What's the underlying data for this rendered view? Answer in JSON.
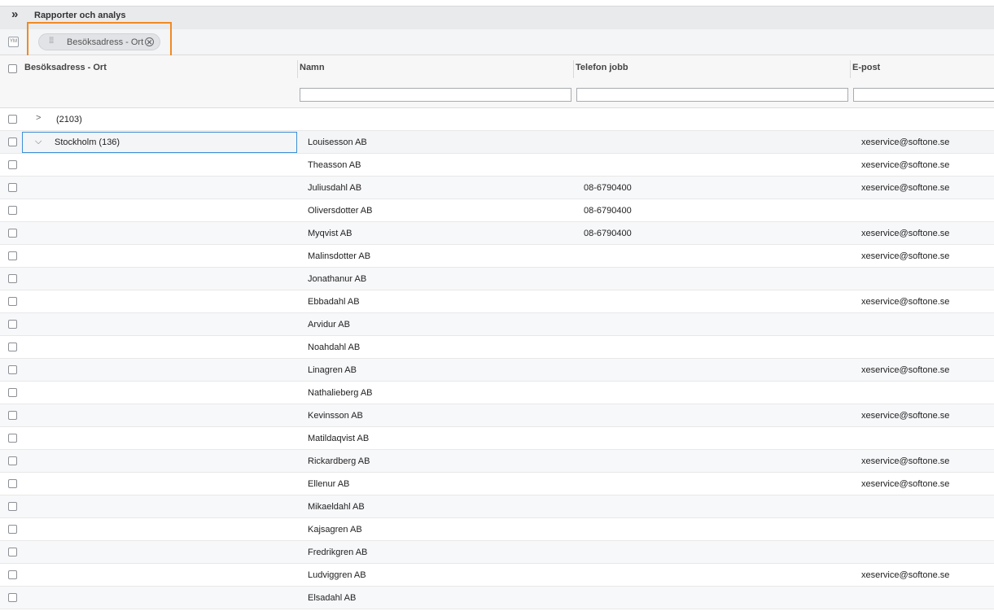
{
  "app": {
    "expand_glyph": "»",
    "title": "Rapporter och analys"
  },
  "groupbar": {
    "group_icon_text": "YM",
    "chip": {
      "label": "Besöksadress - Ort",
      "remove_glyph": "⊗"
    }
  },
  "columns": [
    {
      "label": "Besöksadress - Ort"
    },
    {
      "label": "Namn"
    },
    {
      "label": "Telefon jobb"
    },
    {
      "label": "E-post"
    }
  ],
  "groups": [
    {
      "label": "(2103)",
      "expanded": false
    },
    {
      "label": "Stockholm (136)",
      "expanded": true
    }
  ],
  "rows": [
    {
      "name": "Louisesson AB",
      "phone": "",
      "email": "xeservice@softone.se"
    },
    {
      "name": "Theasson AB",
      "phone": "",
      "email": "xeservice@softone.se"
    },
    {
      "name": "Juliusdahl AB",
      "phone": "08-6790400",
      "email": "xeservice@softone.se"
    },
    {
      "name": "Oliversdotter AB",
      "phone": "08-6790400",
      "email": ""
    },
    {
      "name": "Myqvist AB",
      "phone": "08-6790400",
      "email": "xeservice@softone.se"
    },
    {
      "name": "Malinsdotter AB",
      "phone": "",
      "email": "xeservice@softone.se"
    },
    {
      "name": "Jonathanur AB",
      "phone": "",
      "email": ""
    },
    {
      "name": "Ebbadahl AB",
      "phone": "",
      "email": "xeservice@softone.se"
    },
    {
      "name": "Arvidur AB",
      "phone": "",
      "email": ""
    },
    {
      "name": "Noahdahl AB",
      "phone": "",
      "email": ""
    },
    {
      "name": "Linagren AB",
      "phone": "",
      "email": "xeservice@softone.se"
    },
    {
      "name": "Nathalieberg AB",
      "phone": "",
      "email": ""
    },
    {
      "name": "Kevinsson AB",
      "phone": "",
      "email": "xeservice@softone.se"
    },
    {
      "name": "Matildaqvist AB",
      "phone": "",
      "email": ""
    },
    {
      "name": "Rickardberg AB",
      "phone": "",
      "email": "xeservice@softone.se"
    },
    {
      "name": "Ellenur AB",
      "phone": "",
      "email": "xeservice@softone.se"
    },
    {
      "name": "Mikaeldahl AB",
      "phone": "",
      "email": ""
    },
    {
      "name": "Kajsagren AB",
      "phone": "",
      "email": ""
    },
    {
      "name": "Fredrikgren AB",
      "phone": "",
      "email": ""
    },
    {
      "name": "Ludviggren AB",
      "phone": "",
      "email": "xeservice@softone.se"
    },
    {
      "name": "Elsadahl AB",
      "phone": "",
      "email": ""
    }
  ],
  "icons": {
    "expand": "double-chevron-right-icon",
    "drag": "drag-handle-icon",
    "remove": "circle-x-icon",
    "collapsed": "chevron-right-icon",
    "expanded": "chevron-down-icon"
  },
  "colors": {
    "highlight": "#f08a24",
    "selection": "#3d8fd6"
  }
}
